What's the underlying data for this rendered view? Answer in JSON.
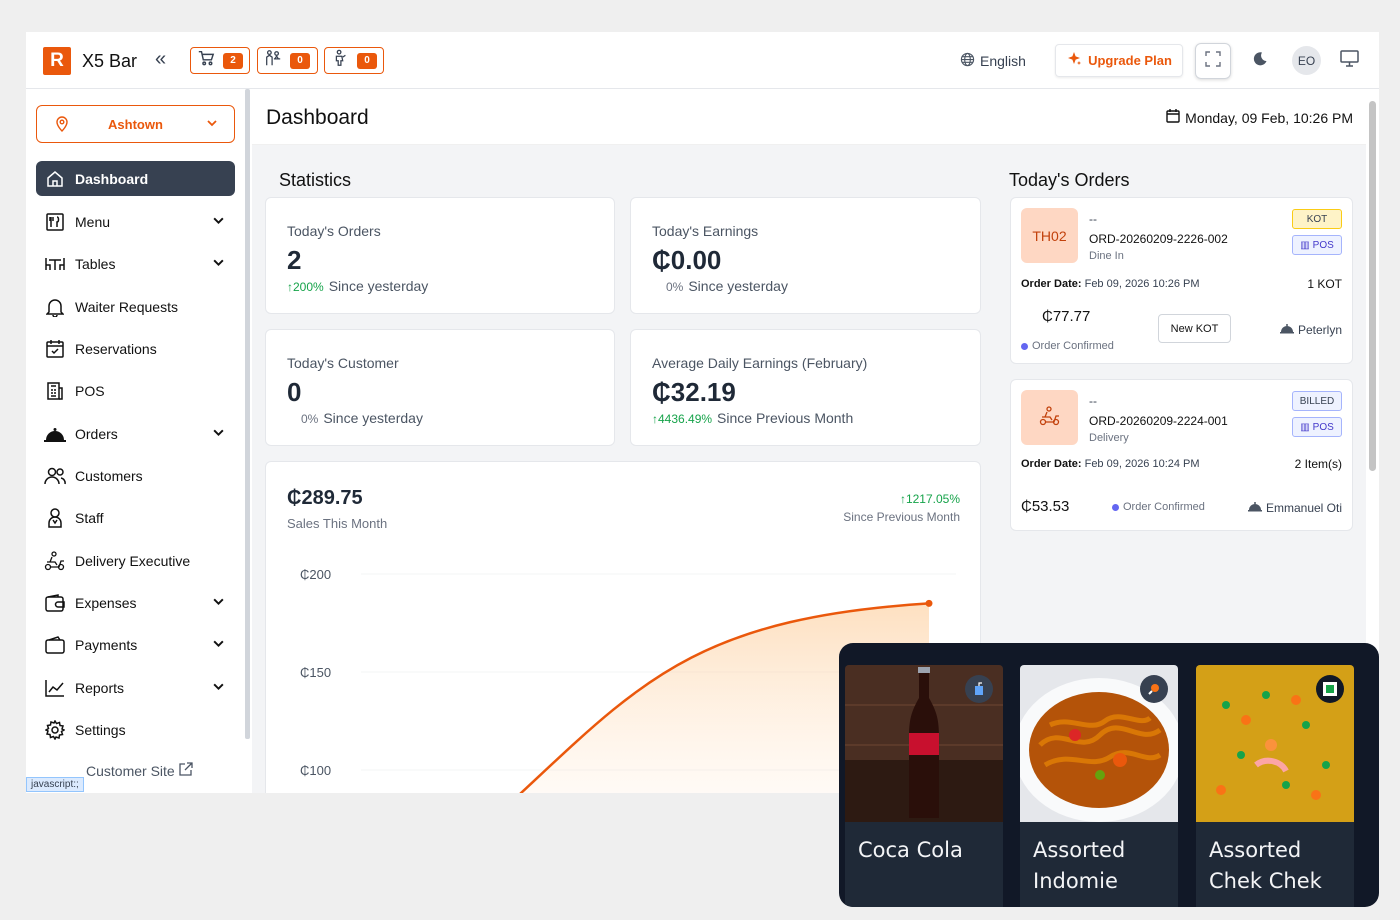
{
  "topbar": {
    "logo_letter": "R",
    "brand": "X5 Bar",
    "collapse_icon": "«",
    "counters": [
      {
        "icon": "cart-icon",
        "count": "2"
      },
      {
        "icon": "waiter-icon",
        "count": "0"
      },
      {
        "icon": "staff-icon",
        "count": "0"
      }
    ],
    "language": "English",
    "upgrade_label": "Upgrade Plan",
    "avatar_initials": "EO"
  },
  "sidebar": {
    "location": "Ashtown",
    "items": [
      {
        "label": "Dashboard",
        "icon": "home-icon",
        "active": true,
        "has_children": false
      },
      {
        "label": "Menu",
        "icon": "menu-book-icon",
        "has_children": true
      },
      {
        "label": "Tables",
        "icon": "table-icon",
        "has_children": true
      },
      {
        "label": "Waiter Requests",
        "icon": "bell-icon",
        "has_children": false
      },
      {
        "label": "Reservations",
        "icon": "calendar-check-icon",
        "has_children": false
      },
      {
        "label": "POS",
        "icon": "pos-icon",
        "has_children": false
      },
      {
        "label": "Orders",
        "icon": "cloche-icon",
        "has_children": true
      },
      {
        "label": "Customers",
        "icon": "users-icon",
        "has_children": false
      },
      {
        "label": "Staff",
        "icon": "staff-icon",
        "has_children": false
      },
      {
        "label": "Delivery Executive",
        "icon": "scooter-icon",
        "has_children": false
      },
      {
        "label": "Expenses",
        "icon": "wallet-icon",
        "has_children": true
      },
      {
        "label": "Payments",
        "icon": "payment-icon",
        "has_children": true
      },
      {
        "label": "Reports",
        "icon": "chart-line-icon",
        "has_children": true
      },
      {
        "label": "Settings",
        "icon": "gear-icon",
        "has_children": false
      }
    ],
    "customer_site": "Customer Site",
    "status_badge": "javascript:;"
  },
  "main": {
    "title": "Dashboard",
    "datetime": "Monday, 09 Feb, 10:26 PM",
    "statistics_title": "Statistics",
    "stats": [
      {
        "label": "Today's Orders",
        "value": "2",
        "pct": "200%",
        "trend": "up",
        "since": "Since yesterday"
      },
      {
        "label": "Today's Earnings",
        "value": "₵0.00",
        "pct": "0%",
        "trend": "flat",
        "since": "Since yesterday"
      },
      {
        "label": "Today's Customer",
        "value": "0",
        "pct": "0%",
        "trend": "flat",
        "since": "Since yesterday"
      },
      {
        "label": "Average Daily Earnings (February)",
        "value": "₵32.19",
        "pct": "4436.49%",
        "trend": "up",
        "since": "Since Previous Month"
      }
    ],
    "sales": {
      "amount": "₵289.75",
      "label": "Sales This Month",
      "pct": "1217.05%",
      "since": "Since Previous Month"
    }
  },
  "chart_data": {
    "type": "area",
    "yticks": [
      "₵200",
      "₵150",
      "₵100"
    ],
    "ytick_values": [
      200,
      150,
      100
    ],
    "color": "#ea580c",
    "curve_end_value": 185
  },
  "orders": {
    "title": "Today's Orders",
    "list": [
      {
        "table": "TH02",
        "dash": "--",
        "id": "ORD-20260209-2226-002",
        "type": "Dine In",
        "tags": [
          "KOT",
          "POS"
        ],
        "date_label": "Order Date:",
        "date": "Feb 09, 2026 10:26 PM",
        "items": "1 KOT",
        "amount": "₵77.77",
        "status": "Order Confirmed",
        "action": "New KOT",
        "waiter": "Peterlyn"
      },
      {
        "table_icon": "scooter-icon",
        "dash": "--",
        "id": "ORD-20260209-2224-001",
        "type": "Delivery",
        "tags": [
          "BILLED",
          "POS"
        ],
        "date_label": "Order Date:",
        "date": "Feb 09, 2026 10:24 PM",
        "items": "2 Item(s)",
        "amount": "₵53.53",
        "status": "Order Confirmed",
        "waiter": "Emmanuel Oti"
      }
    ]
  },
  "menu_overlay": {
    "items": [
      {
        "name_line1": "Coca Cola",
        "name_line2": "",
        "badge": "drink-icon"
      },
      {
        "name_line1": "Assorted",
        "name_line2": "Indomie",
        "badge": "chicken-leg-icon"
      },
      {
        "name_line1": "Assorted",
        "name_line2": "Chek Chek",
        "badge": "veg-icon"
      }
    ]
  }
}
